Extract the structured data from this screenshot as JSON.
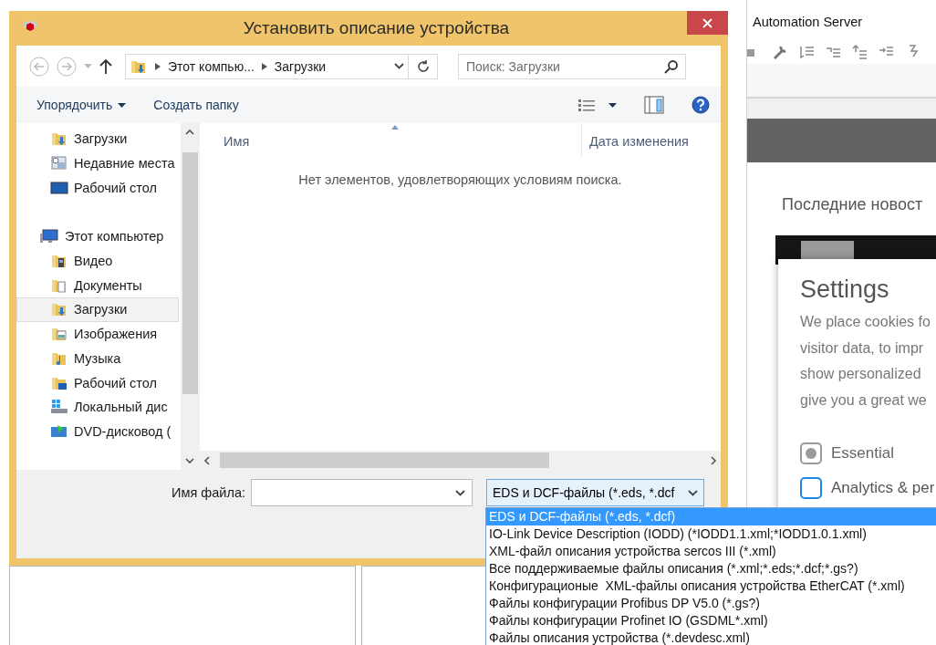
{
  "window": {
    "title": "Установить описание устройства"
  },
  "address_bar": {
    "path": [
      "Этот компью...",
      "Загрузки"
    ]
  },
  "search": {
    "placeholder": "Поиск: Загрузки"
  },
  "commands": [
    {
      "label": "Упорядочить",
      "kind": "menu"
    },
    {
      "label": "Создать папку",
      "kind": "button"
    }
  ],
  "navigation": [
    {
      "label": "Загрузки",
      "kind": "folder-download",
      "selected": false
    },
    {
      "label": "Недавние места",
      "kind": "recent",
      "selected": false
    },
    {
      "label": "Рабочий стол",
      "kind": "desktop",
      "selected": false
    },
    {
      "label": "Этот компьютер",
      "kind": "computer",
      "selected": false,
      "children": [
        {
          "label": "Видео",
          "kind": "folder-video",
          "selected": false
        },
        {
          "label": "Документы",
          "kind": "folder-docs",
          "selected": false
        },
        {
          "label": "Загрузки",
          "kind": "folder-download",
          "selected": true
        },
        {
          "label": "Изображения",
          "kind": "folder-pictures",
          "selected": false
        },
        {
          "label": "Музыка",
          "kind": "folder-music",
          "selected": false
        },
        {
          "label": "Рабочий стол",
          "kind": "folder-desktop",
          "selected": false
        },
        {
          "label": "Локальный дис",
          "kind": "drive-local",
          "selected": false
        },
        {
          "label": "DVD-дисковод (",
          "kind": "drive-dvd",
          "selected": false
        }
      ]
    }
  ],
  "file_list": {
    "columns": [
      "Имя",
      "Дата изменения"
    ],
    "empty_message": "Нет элементов, удовлетворяющих условиям поиска."
  },
  "file_name": {
    "label": "Имя файла:"
  },
  "file_type": {
    "value": "EDS и DCF-файлы (*.eds, *.dcf",
    "options": [
      {
        "label": "EDS и DCF-файлы (*.eds, *.dcf)",
        "selected": true
      },
      {
        "label": "IO-Link Device Description (IODD) (*IODD1.1.xml;*IODD1.0.1.xml)",
        "selected": false
      },
      {
        "label": "XML-файл описания устройства sercos III (*.xml)",
        "selected": false
      },
      {
        "label": "Все поддерживаемые файлы описания (*.xml;*.eds;*.dcf;*.gs?)",
        "selected": false
      },
      {
        "label": "Конфигурационые  XML-файлы описания устройства EtherCAT (*.xml)",
        "selected": false
      },
      {
        "label": "Файлы конфигурации Profibus DP V5.0 (*.gs?)",
        "selected": false
      },
      {
        "label": "Файлы конфигурации Profinet IO (GSDML*.xml)",
        "selected": false
      },
      {
        "label": "Файлы описания устройства (*.devdesc.xml)",
        "selected": false
      }
    ]
  },
  "app": {
    "title": "Automation Server",
    "news_heading": "Последние новост",
    "cookie_dialog": {
      "title": "Settings",
      "text_lines": [
        "We place cookies fo",
        "visitor data, to impr",
        "show personalized",
        "give you a great we"
      ],
      "options": [
        {
          "label": "Essential",
          "checked": true,
          "disabled": true
        },
        {
          "label": "Analytics & per",
          "checked": false,
          "disabled": false
        }
      ]
    }
  }
}
